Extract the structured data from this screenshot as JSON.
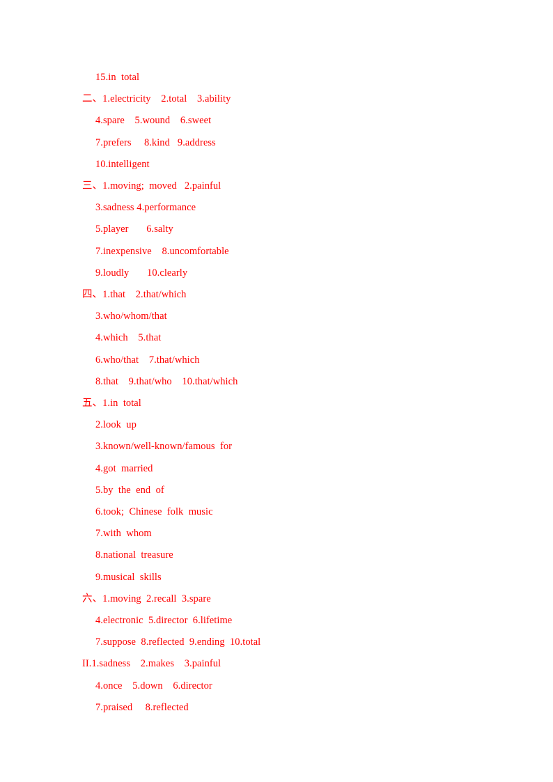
{
  "document": {
    "type": "answer-key",
    "text_color": "#ff0000",
    "background_color": "#ffffff",
    "lines": [
      {
        "marker": "",
        "text": "15.in  total"
      },
      {
        "marker": "二、",
        "text": "1.electricity    2.total    3.ability"
      },
      {
        "marker": "",
        "text": "4.spare    5.wound    6.sweet"
      },
      {
        "marker": "",
        "text": "7.prefers     8.kind   9.address"
      },
      {
        "marker": "",
        "text": "10.intelligent"
      },
      {
        "marker": "三、",
        "text": "1.moving;  moved   2.painful"
      },
      {
        "marker": "",
        "text": "3.sadness 4.performance"
      },
      {
        "marker": "",
        "text": "5.player       6.salty"
      },
      {
        "marker": "",
        "text": "7.inexpensive    8.uncomfortable"
      },
      {
        "marker": "",
        "text": "9.loudly       10.clearly"
      },
      {
        "marker": "四、",
        "text": "1.that    2.that/which"
      },
      {
        "marker": "",
        "text": "3.who/whom/that"
      },
      {
        "marker": "",
        "text": "4.which    5.that"
      },
      {
        "marker": "",
        "text": "6.who/that    7.that/which"
      },
      {
        "marker": "",
        "text": "8.that    9.that/who    10.that/which"
      },
      {
        "marker": "五、",
        "text": "1.in  total"
      },
      {
        "marker": "",
        "text": "2.look  up"
      },
      {
        "marker": "",
        "text": "3.known/well-known/famous  for"
      },
      {
        "marker": "",
        "text": "4.got  married"
      },
      {
        "marker": "",
        "text": "5.by  the  end  of"
      },
      {
        "marker": "",
        "text": "6.took;  Chinese  folk  music"
      },
      {
        "marker": "",
        "text": "7.with  whom"
      },
      {
        "marker": "",
        "text": "8.national  treasure"
      },
      {
        "marker": "",
        "text": "9.musical  skills"
      },
      {
        "marker": "六、",
        "text": "1.moving  2.recall  3.spare"
      },
      {
        "marker": "",
        "text": "4.electronic  5.director  6.lifetime"
      },
      {
        "marker": "",
        "text": "7.suppose  8.reflected  9.ending  10.total"
      },
      {
        "marker": "II.",
        "text": "1.sadness    2.makes    3.painful"
      },
      {
        "marker": "",
        "text": "4.once    5.down    6.director"
      },
      {
        "marker": "",
        "text": "7.praised     8.reflected"
      }
    ]
  }
}
